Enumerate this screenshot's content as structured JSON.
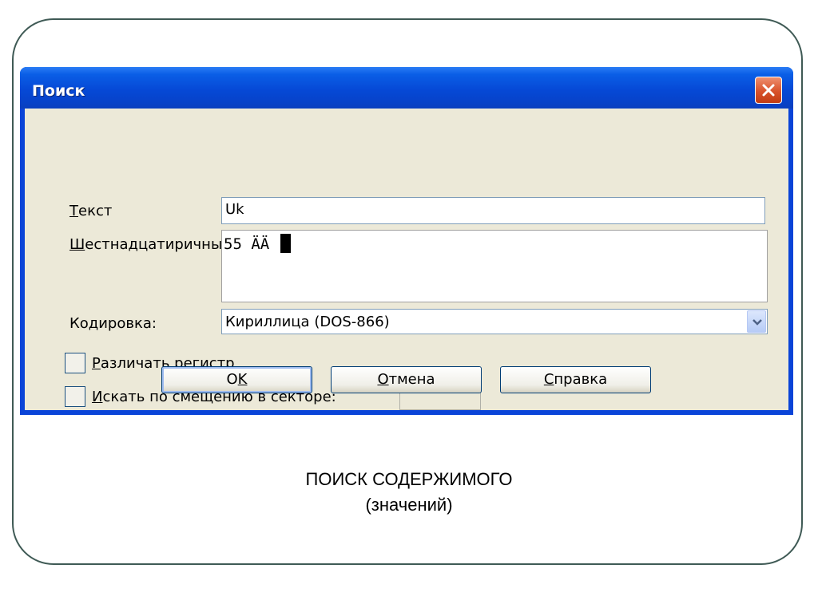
{
  "dialog": {
    "title": "Поиск",
    "fields": {
      "text_label_first": "Т",
      "text_label_rest": "екст",
      "text_value": "Uk",
      "hex_label_first": "Ш",
      "hex_label_rest": "естнадцатиричный:",
      "hex_value": "55 ÄÄ ",
      "encoding_label": "Кодировка:",
      "encoding_value": "Кириллица (DOS-866)"
    },
    "options": {
      "case_label_first": "Р",
      "case_label_rest": "азличать регистр",
      "offset_label_first": "И",
      "offset_label_rest": "скать по смещению в секторе:"
    },
    "buttons": {
      "ok_a": "O",
      "ok_b": "K",
      "cancel_first": "О",
      "cancel_rest": "тмена",
      "help_first": "С",
      "help_rest": "правка"
    }
  },
  "caption": {
    "line1": "ПОИСК СОДЕРЖИМОГО",
    "line2": "(значений)"
  },
  "icons": {
    "close": "close-icon",
    "dropdown": "chevron-down-icon"
  },
  "colors": {
    "titlebar": "#0649d6",
    "client_bg": "#ece9d8",
    "close_button": "#d8522b",
    "frame_border": "#3f5a55"
  }
}
